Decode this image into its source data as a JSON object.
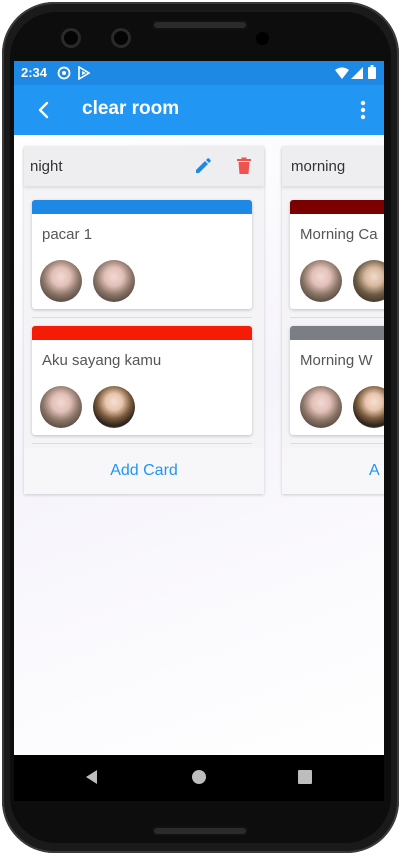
{
  "status_bar": {
    "time": "2:34",
    "icons": [
      "vpn-icon",
      "play-store-icon",
      "wifi-icon",
      "signal-icon",
      "battery-icon"
    ]
  },
  "app_bar": {
    "title": "clear room",
    "back_icon": "arrow-back-icon",
    "menu_icon": "more-vert-icon"
  },
  "colors": {
    "status_bar": "#1e88e5",
    "app_bar": "#2196f3",
    "edit_icon": "#1e88e5",
    "delete_icon": "#ef5350",
    "add_card_text": "#2196f3"
  },
  "columns": [
    {
      "title": "night",
      "cards": [
        {
          "title": "pacar 1",
          "label_color": "#1e88e5",
          "avatars": [
            "member-avatar",
            "member-avatar"
          ]
        },
        {
          "title": "Aku sayang kamu",
          "label_color": "#f41c06",
          "avatars": [
            "member-avatar",
            "member-avatar"
          ]
        }
      ],
      "add_card_label": "Add Card"
    },
    {
      "title": "morning",
      "cards": [
        {
          "title": "Morning Ca",
          "label_color": "#7b0000",
          "avatars": [
            "member-avatar",
            "member-avatar"
          ]
        },
        {
          "title": "Morning W",
          "label_color": "#7b7f85",
          "avatars": [
            "member-avatar",
            "member-avatar"
          ]
        }
      ],
      "add_card_label": "A"
    }
  ],
  "nav_bar": {
    "icons": [
      "back-triangle-icon",
      "home-circle-icon",
      "recents-square-icon"
    ]
  }
}
